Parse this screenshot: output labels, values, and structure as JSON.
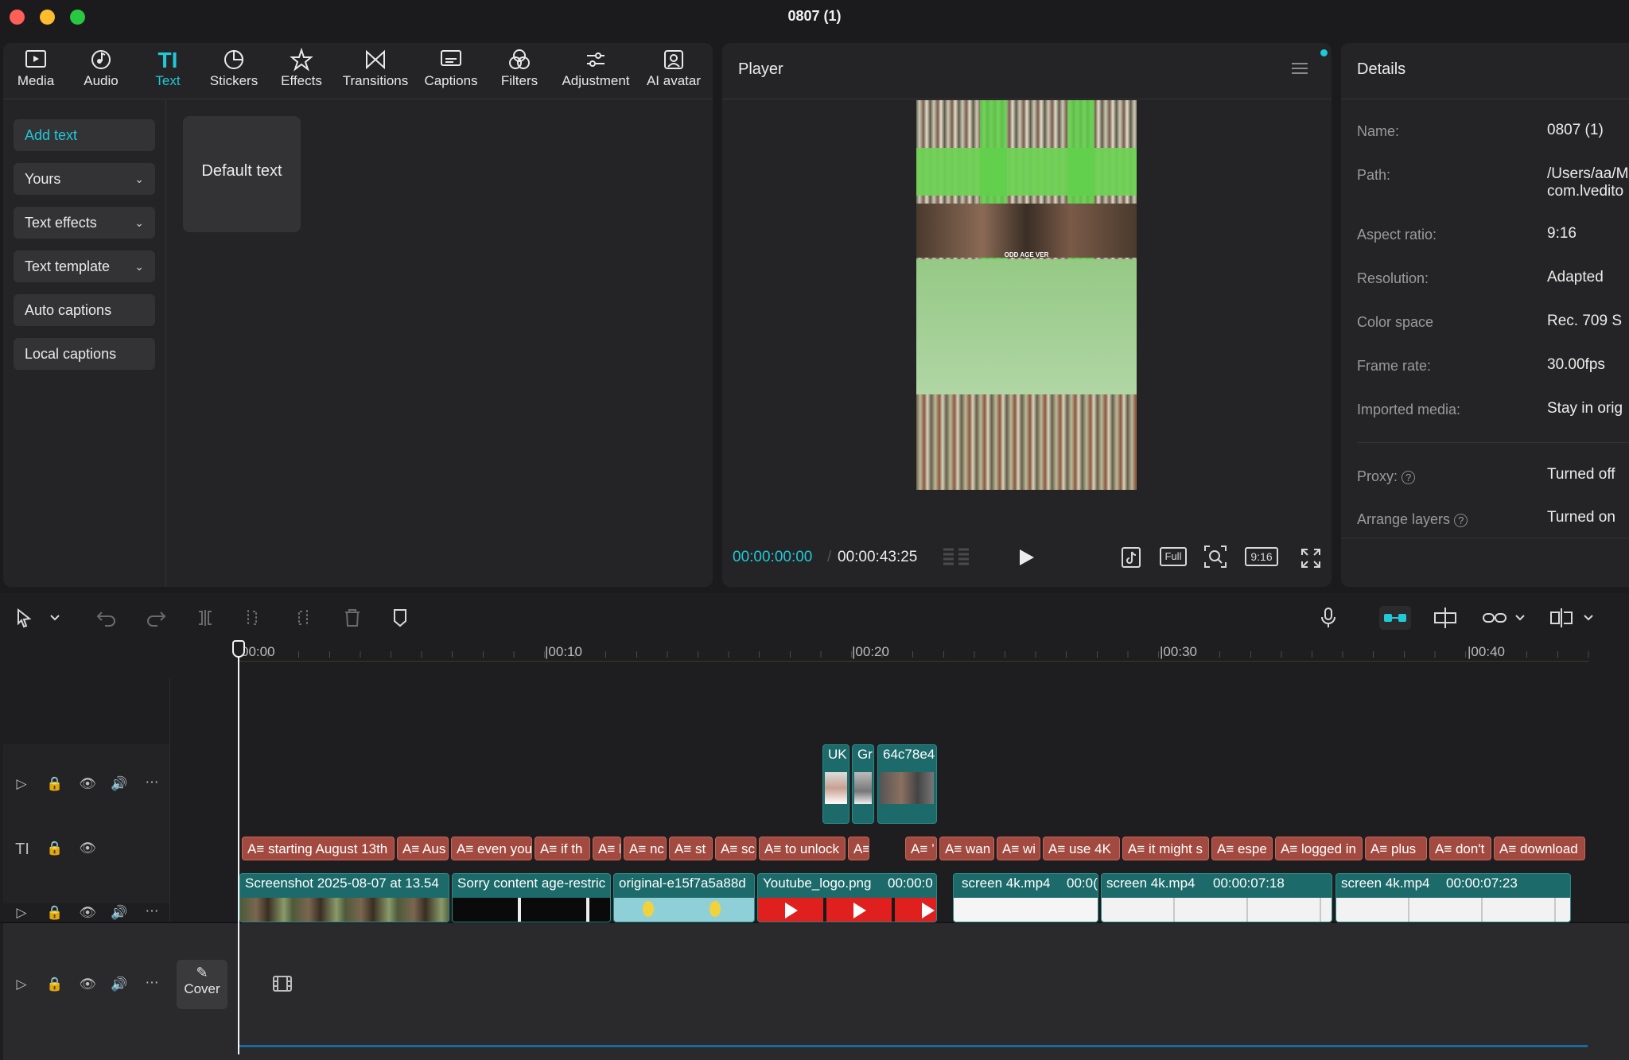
{
  "window": {
    "title": "0807 (1)"
  },
  "colors": {
    "accent": "#20c8d8",
    "text_clip": "#a34a40",
    "video_clip": "#1c6a6a",
    "close": "#ff5f57",
    "minimize": "#febc2e",
    "zoom": "#28c840"
  },
  "toolbar": {
    "items": [
      {
        "label": "Media",
        "icon": "media-icon"
      },
      {
        "label": "Audio",
        "icon": "audio-icon"
      },
      {
        "label": "Text",
        "icon": "text-icon"
      },
      {
        "label": "Stickers",
        "icon": "stickers-icon"
      },
      {
        "label": "Effects",
        "icon": "effects-icon"
      },
      {
        "label": "Transitions",
        "icon": "transitions-icon"
      },
      {
        "label": "Captions",
        "icon": "captions-icon"
      },
      {
        "label": "Filters",
        "icon": "filters-icon"
      },
      {
        "label": "Adjustment",
        "icon": "adjustment-icon"
      },
      {
        "label": "AI avatar",
        "icon": "ai-avatar-icon"
      }
    ],
    "active": "Text"
  },
  "sidebar": {
    "items": [
      {
        "label": "Add text"
      },
      {
        "label": "Yours"
      },
      {
        "label": "Text effects"
      },
      {
        "label": "Text template"
      },
      {
        "label": "Auto captions"
      },
      {
        "label": "Local captions"
      }
    ]
  },
  "text_panel": {
    "default_card": "Default text"
  },
  "player": {
    "title": "Player",
    "current_time": "00:00:00:00",
    "total_time": "00:00:43:25",
    "buttons": [
      "Full",
      "9:16"
    ],
    "preview_text": "ODD AGE VER"
  },
  "details": {
    "title": "Details",
    "rows": [
      {
        "label": "Name:",
        "value": "0807 (1)"
      },
      {
        "label": "Path:",
        "value": "/Users/aa/M",
        "value2": "com.lvedito"
      },
      {
        "label": "Aspect ratio:",
        "value": "9:16"
      },
      {
        "label": "Resolution:",
        "value": "Adapted"
      },
      {
        "label": "Color space",
        "value": "Rec. 709 S"
      },
      {
        "label": "Frame rate:",
        "value": "30.00fps"
      },
      {
        "label": "Imported media:",
        "value": "Stay in orig"
      },
      {
        "label": "Proxy:",
        "value": "Turned off"
      },
      {
        "label": "Arrange layers",
        "value": "Turned on"
      }
    ]
  },
  "timeline": {
    "ruler": [
      "00:00",
      "|00:10",
      "|00:20",
      "|00:30",
      "|00:40"
    ],
    "cover_label": "Cover",
    "overlay_clips": [
      "UK",
      "Gr",
      "64c78e4"
    ],
    "text_clips": [
      "A≡ starting August 13th",
      "A≡ Aus",
      "A≡ even you",
      "A≡ if th",
      "A≡ l",
      "A≡ nc",
      "A≡ st",
      "A≡ sc",
      "A≡ to unlock",
      "A≡",
      "A≡ ’",
      "A≡ wan",
      "A≡ wi",
      "A≡ use 4K",
      "A≡ it might s",
      "A≡ espe",
      "A≡ logged in",
      "A≡ plus",
      "A≡ don't",
      "A≡ download"
    ],
    "video_clips": [
      {
        "label": "Screenshot 2025-08-07 at 13.54",
        "duration": ""
      },
      {
        "label": "Sorry content age-restric",
        "duration": ""
      },
      {
        "label": "original-e15f7a5a88d",
        "duration": ""
      },
      {
        "label": "Youtube_logo.png",
        "duration": "00:00:0"
      },
      {
        "label": "screen 4k.mp4",
        "duration": "00:0("
      },
      {
        "label": "screen 4k.mp4",
        "duration": "00:00:07:18"
      },
      {
        "label": "screen 4k.mp4",
        "duration": "00:00:07:23"
      }
    ]
  }
}
